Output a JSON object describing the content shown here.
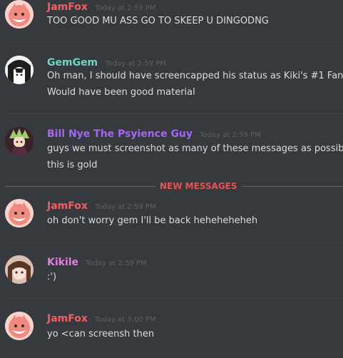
{
  "colors": {
    "background": "#36393e",
    "jamfox": "#f25f62",
    "gemgem": "#70d6c3",
    "billnye": "#a567f0",
    "kikile": "#e57de8",
    "new_messages": "#e35555",
    "text": "#dcddde",
    "timestamp": "#5e6066"
  },
  "messages": [
    {
      "username": "JamFox",
      "timestamp": "Today at 2:59 PM",
      "avatar_icon": "jamfox-avatar-icon",
      "lines": [
        "TOO GOOD MU ASS GO TO SKEEP U DINGODNG"
      ]
    },
    {
      "username": "GemGem",
      "timestamp": "Today at 2:59 PM",
      "avatar_icon": "gemgem-avatar-icon",
      "lines": [
        "Oh man, I should have screencapped his status as Kiki's #1 Fan",
        "Would have been good material"
      ]
    },
    {
      "username": "Bill Nye The Psyience Guy",
      "timestamp": "Today at 2:59 PM",
      "avatar_icon": "billnye-avatar-icon",
      "lines": [
        "guys we must screenshot as many of these messages as possible",
        "this is gold"
      ]
    },
    {
      "username": "JamFox",
      "timestamp": "Today at 2:59 PM",
      "avatar_icon": "jamfox-avatar-icon",
      "lines": [
        "oh don't worry gem I'll be back heheheheheh"
      ]
    },
    {
      "username": "Kikile",
      "timestamp": "Today at 2:59 PM",
      "avatar_icon": "kikile-avatar-icon",
      "lines": [
        ":')"
      ]
    },
    {
      "username": "JamFox",
      "timestamp": "Today at 3:00 PM",
      "avatar_icon": "jamfox-avatar-icon",
      "lines": [
        "yo  <can screensh then"
      ]
    }
  ],
  "new_messages_label": "NEW MESSAGES"
}
